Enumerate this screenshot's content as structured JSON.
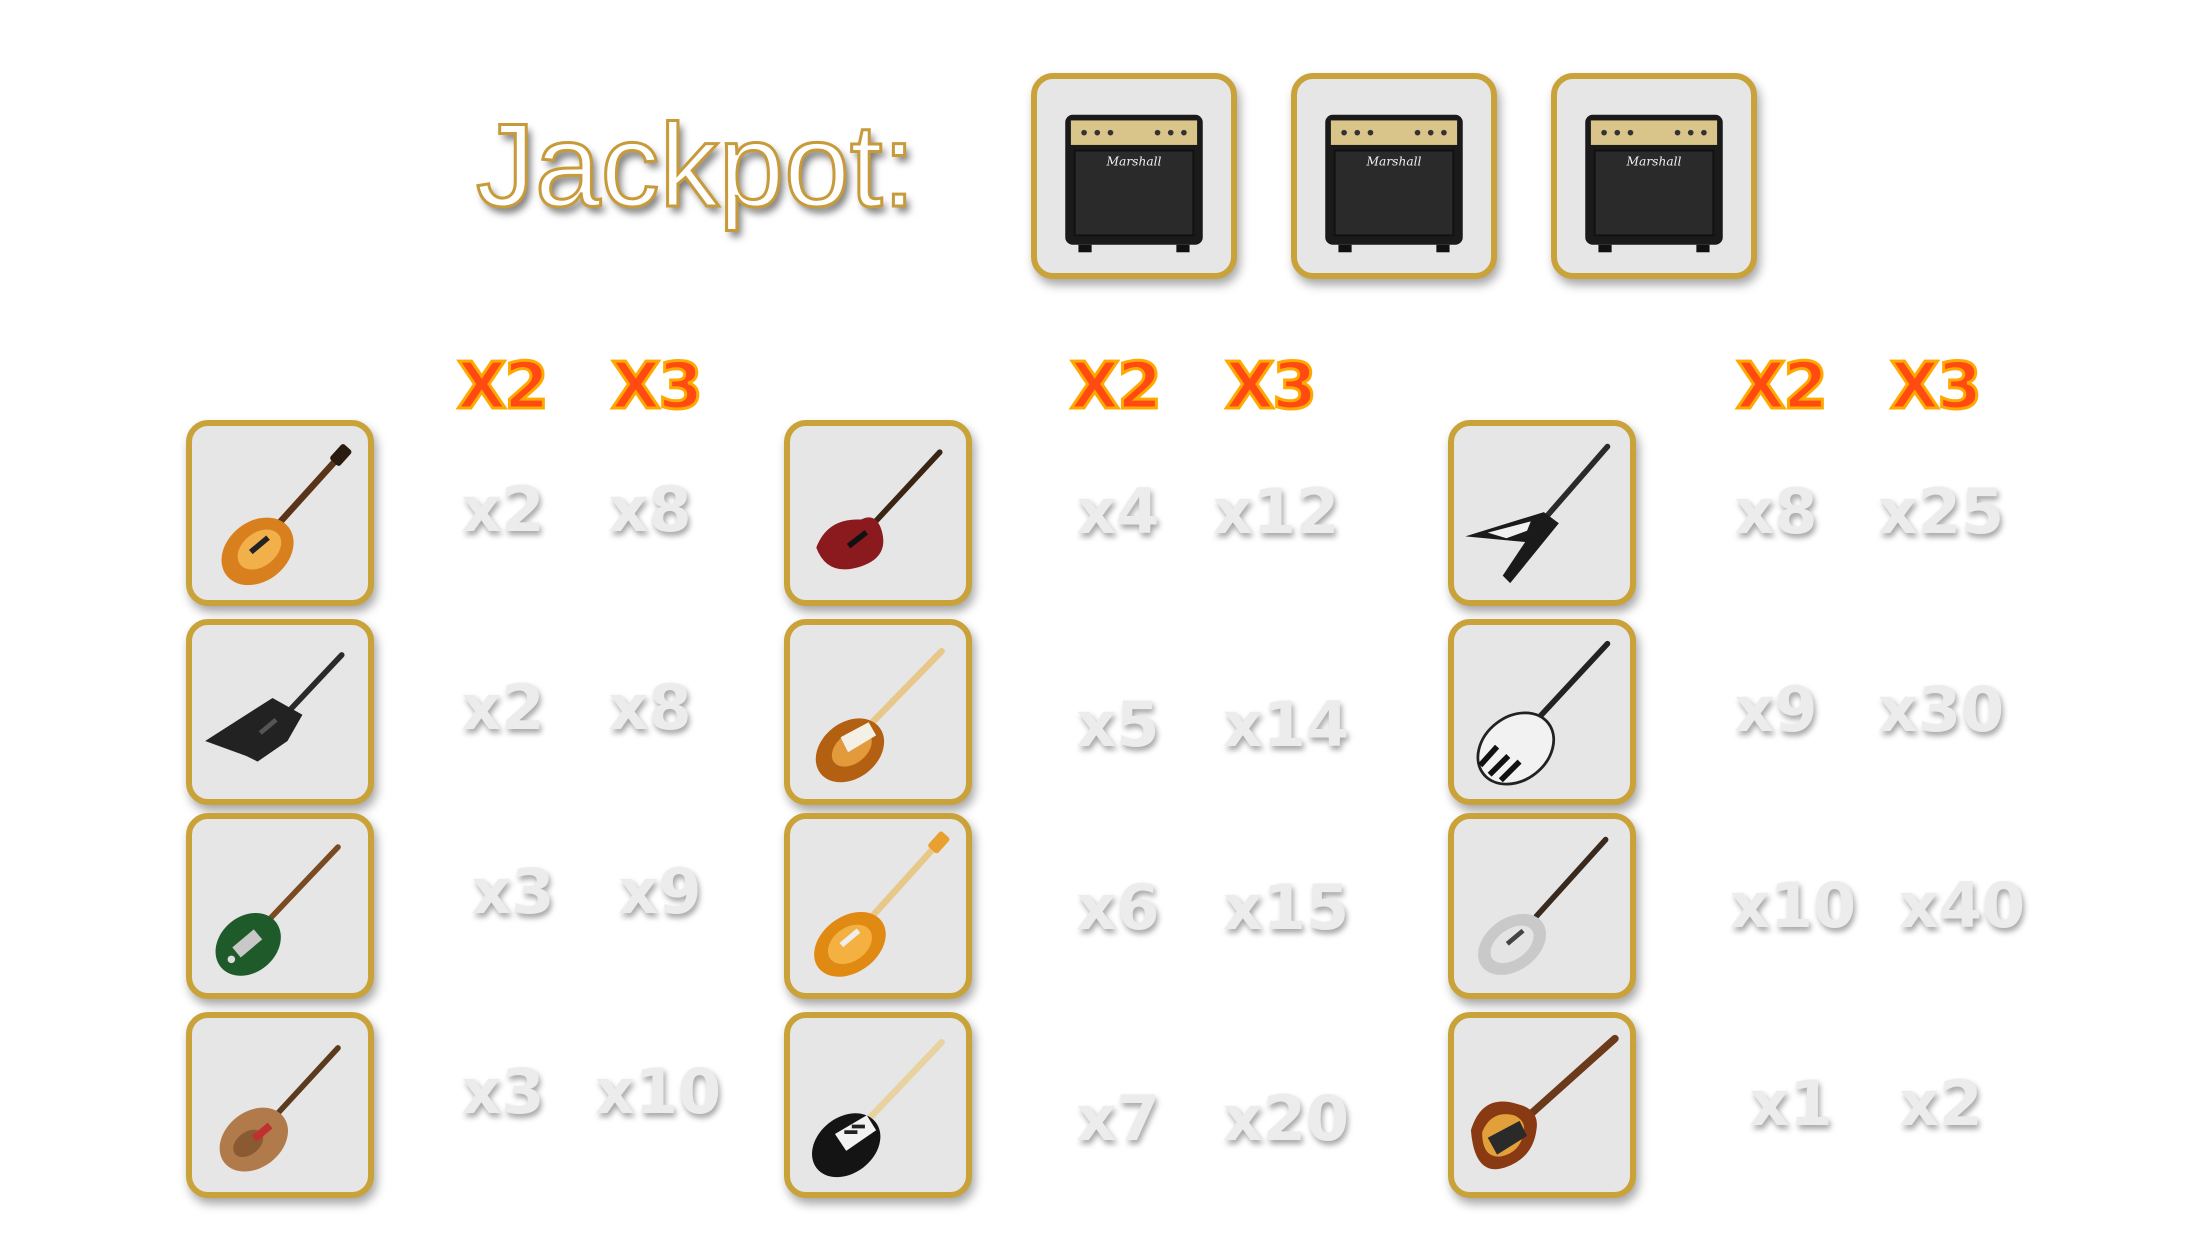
{
  "jackpot": {
    "label": "Jackpot:",
    "symbols": [
      "amplifier-icon",
      "amplifier-icon",
      "amplifier-icon"
    ],
    "amp_brand": "Marshall"
  },
  "columns": [
    {
      "header_x2": "X2",
      "header_x3": "X3",
      "rows": [
        {
          "icon": "sunburst-les-paul-guitar-icon",
          "x2": "x2",
          "x3": "x8"
        },
        {
          "icon": "black-explorer-guitar-icon",
          "x2": "x2",
          "x3": "x8"
        },
        {
          "icon": "green-offset-guitar-icon",
          "x2": "x3",
          "x3": "x9"
        },
        {
          "icon": "quilted-superstrat-guitar-icon",
          "x2": "x3",
          "x3": "x10"
        }
      ]
    },
    {
      "header_x2": "X2",
      "header_x3": "X3",
      "rows": [
        {
          "icon": "red-sg-guitar-icon",
          "x2": "x4",
          "x3": "x12"
        },
        {
          "icon": "sunburst-telecaster-guitar-icon",
          "x2": "x5",
          "x3": "x14"
        },
        {
          "icon": "amber-axis-guitar-icon",
          "x2": "x6",
          "x3": "x15"
        },
        {
          "icon": "black-stratocaster-guitar-icon",
          "x2": "x7",
          "x3": "x20"
        }
      ]
    },
    {
      "header_x2": "X2",
      "header_x3": "X3",
      "rows": [
        {
          "icon": "flying-v-guitar-icon",
          "x2": "x8",
          "x3": "x25"
        },
        {
          "icon": "white-les-paul-guitar-icon",
          "x2": "x9",
          "x3": "x30"
        },
        {
          "icon": "silver-superstrat-guitar-icon",
          "x2": "x10",
          "x3": "x40"
        },
        {
          "icon": "sunburst-jazz-bass-guitar-icon",
          "x2": "x1",
          "x3": "x2"
        }
      ]
    }
  ],
  "colors": {
    "tile_border": "#c9a23a",
    "tile_bg": "#e6e6e6",
    "header_fill": "#ff4a12",
    "header_stroke": "#ffa800",
    "multiplier_text": "#ececec"
  }
}
